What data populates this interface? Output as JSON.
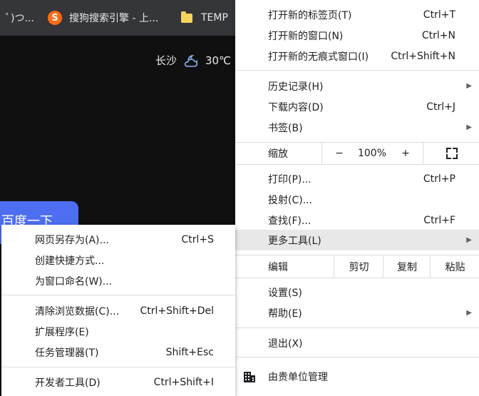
{
  "bookmarks": [
    {
      "label": "ﾟ)つ..."
    },
    {
      "label": "搜狗搜索引擎 - 上...",
      "icon": "sogou-icon"
    },
    {
      "label": "TEMP",
      "icon": "folder-icon"
    }
  ],
  "sogou_glyph": "S",
  "weather": {
    "city": "长沙",
    "temp": "30℃",
    "icon": "cloud-moon-icon"
  },
  "baidu_button": "百度一下",
  "menu": {
    "new_tab": {
      "label": "打开新的标签页(T)",
      "shortcut": "Ctrl+T"
    },
    "new_window": {
      "label": "打开新的窗口(N)",
      "shortcut": "Ctrl+N"
    },
    "new_incognito": {
      "label": "打开新的无痕式窗口(I)",
      "shortcut": "Ctrl+Shift+N"
    },
    "history": {
      "label": "历史记录(H)"
    },
    "downloads": {
      "label": "下载内容(D)",
      "shortcut": "Ctrl+J"
    },
    "bookmarks": {
      "label": "书签(B)"
    },
    "zoom": {
      "label": "缩放",
      "minus": "−",
      "value": "100%",
      "plus": "+"
    },
    "print": {
      "label": "打印(P)...",
      "shortcut": "Ctrl+P"
    },
    "cast": {
      "label": "投射(C)..."
    },
    "find": {
      "label": "查找(F)...",
      "shortcut": "Ctrl+F"
    },
    "more_tools": {
      "label": "更多工具(L)"
    },
    "edit": {
      "label": "编辑",
      "cut": "剪切",
      "copy": "复制",
      "paste": "粘贴"
    },
    "settings": {
      "label": "设置(S)"
    },
    "help": {
      "label": "帮助(E)"
    },
    "exit": {
      "label": "退出(X)"
    },
    "managed": {
      "label": "由贵单位管理",
      "icon": "building-icon"
    }
  },
  "submenu": {
    "save_page": {
      "label": "网页另存为(A)...",
      "shortcut": "Ctrl+S"
    },
    "create_shortcut": {
      "label": "创建快捷方式..."
    },
    "name_window": {
      "label": "为窗口命名(W)..."
    },
    "clear_data": {
      "label": "清除浏览数据(C)...",
      "shortcut": "Ctrl+Shift+Del"
    },
    "extensions": {
      "label": "扩展程序(E)"
    },
    "task_manager": {
      "label": "任务管理器(T)",
      "shortcut": "Shift+Esc"
    },
    "dev_tools": {
      "label": "开发者工具(D)",
      "shortcut": "Ctrl+Shift+I"
    }
  },
  "colors": {
    "page_bg": "#101010",
    "bookmark_bar": "#35363a",
    "baidu_blue": "#4e6ef2",
    "sogou_orange": "#ff6a13",
    "highlight": "#e8e8e9"
  }
}
